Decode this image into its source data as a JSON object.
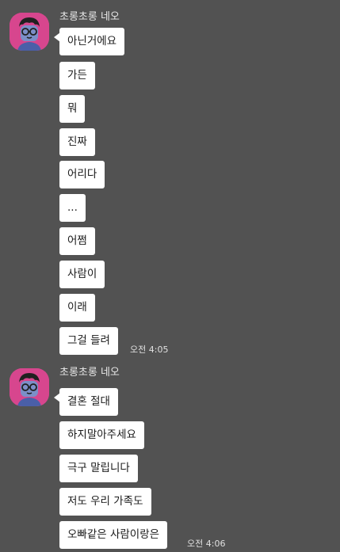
{
  "groups": [
    {
      "sender": "초롱초롱 네오",
      "messages": [
        "아닌거에요",
        "가든",
        "뭐",
        "진짜",
        "어리다",
        "...",
        "어쩜",
        "사람이",
        "이래",
        "그걸 들려"
      ],
      "time": "오전 4:05"
    },
    {
      "sender": "초롱초롱 네오",
      "messages": [
        "결혼 절대",
        "하지말아주세요",
        "극구 말립니다",
        "저도 우리 가족도",
        "오빠같은 사람이랑은"
      ],
      "time": "오전 4:06"
    }
  ],
  "colors": {
    "background": "#525252",
    "bubble": "#ffffff",
    "avatar_bg": "#d7468e",
    "name_text": "#e8e8e8"
  },
  "icons": {
    "avatar": "neo-character-avatar"
  }
}
